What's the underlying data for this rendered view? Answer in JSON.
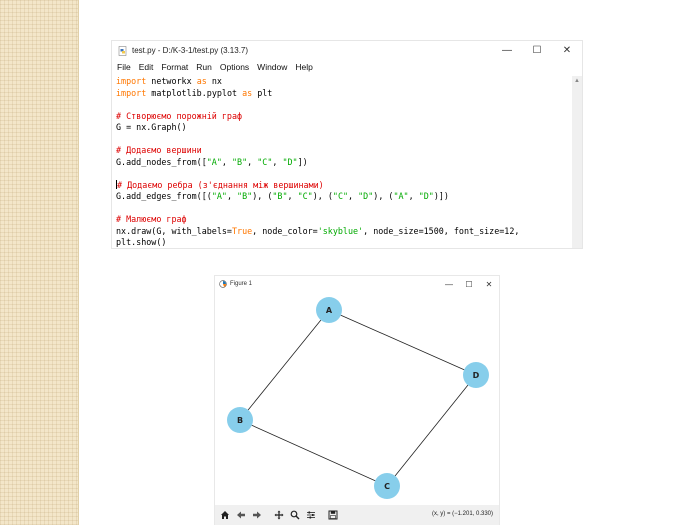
{
  "editor": {
    "title": "test.py - D:/K-3-1/test.py (3.13.7)",
    "controls": {
      "minimize": "—",
      "maximize": "☐",
      "close": "✕"
    },
    "menu": [
      "File",
      "Edit",
      "Format",
      "Run",
      "Options",
      "Window",
      "Help"
    ],
    "code": {
      "l1_kw": "import",
      "l1_rest": " networkx ",
      "l1_kw2": "as",
      "l1_rest2": " nx",
      "l2_kw": "import",
      "l2_rest": " matplotlib.pyplot ",
      "l2_kw2": "as",
      "l2_rest2": " plt",
      "c1": "# Створюємо порожній граф",
      "l4": "G = nx.Graph()",
      "c2": "# Додаємо вершини",
      "l6_a": "G.add_nodes_from([",
      "l6_s1": "\"A\"",
      "l6_c1": ", ",
      "l6_s2": "\"B\"",
      "l6_c2": ", ",
      "l6_s3": "\"C\"",
      "l6_c3": ", ",
      "l6_s4": "\"D\"",
      "l6_b": "])",
      "c3": "# Додаємо ребра (з'єднання між вершинами)",
      "l8_a": "G.add_edges_from([(",
      "l8_s1": "\"A\"",
      "l8_c1": ", ",
      "l8_s2": "\"B\"",
      "l8_p1": "), (",
      "l8_s3": "\"B\"",
      "l8_c2": ", ",
      "l8_s4": "\"C\"",
      "l8_p2": "), (",
      "l8_s5": "\"C\"",
      "l8_c3": ", ",
      "l8_s6": "\"D\"",
      "l8_p3": "), (",
      "l8_s7": "\"A\"",
      "l8_c4": ", ",
      "l8_s8": "\"D\"",
      "l8_b": ")])",
      "c4": "# Малюємо граф",
      "l10_a": "nx.draw(G, with_labels=",
      "l10_true": "True",
      "l10_b": ", node_color=",
      "l10_s": "'skyblue'",
      "l10_c": ", node_size=1500, font_size=12,",
      "l11": "plt.show()"
    }
  },
  "figure": {
    "title": "Figure 1",
    "controls": {
      "minimize": "—",
      "maximize": "☐",
      "close": "✕"
    },
    "node_color": "#87ceeb",
    "nodes": [
      "A",
      "B",
      "C",
      "D"
    ],
    "edges": [
      [
        "A",
        "B"
      ],
      [
        "B",
        "C"
      ],
      [
        "C",
        "D"
      ],
      [
        "A",
        "D"
      ]
    ],
    "toolbar_icons": [
      "home-icon",
      "back-icon",
      "forward-icon",
      "pan-icon",
      "zoom-icon",
      "configure-icon",
      "save-icon"
    ],
    "coords_text": "(x, y) = (−1.201, 0.330)"
  }
}
